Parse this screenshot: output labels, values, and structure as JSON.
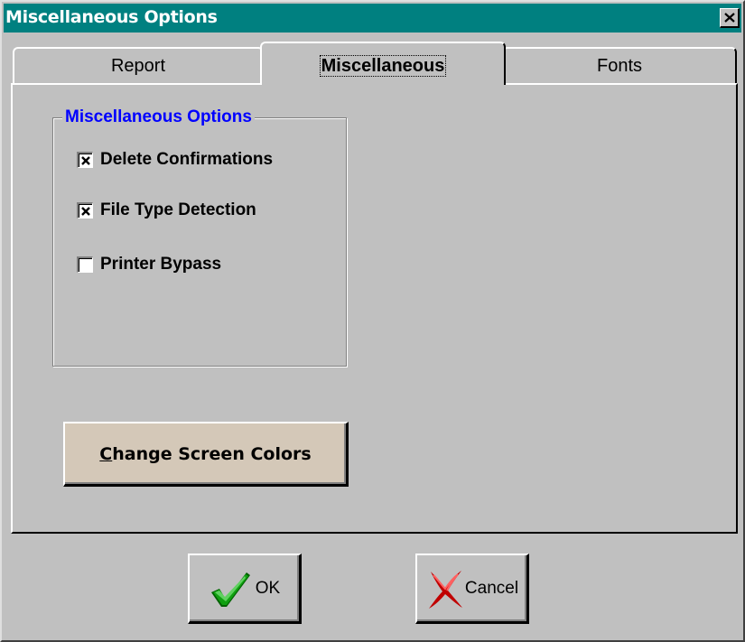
{
  "window": {
    "title": "Miscellaneous Options",
    "close_icon": "close-icon"
  },
  "tabs": [
    {
      "label": "Report",
      "active": false
    },
    {
      "label": "Miscellaneous",
      "active": true
    },
    {
      "label": "Fonts",
      "active": false
    }
  ],
  "group": {
    "legend": "Miscellaneous Options",
    "legend_color": "#0000ff",
    "options": [
      {
        "label": "Delete Confirmations",
        "checked": true
      },
      {
        "label": "File Type Detection",
        "checked": true
      },
      {
        "label": "Printer Bypass",
        "checked": false
      }
    ]
  },
  "change_colors_button": {
    "accel": "C",
    "rest": "hange Screen Colors"
  },
  "ok_button": {
    "label": "OK",
    "icon": "checkmark-icon"
  },
  "cancel_button": {
    "label": "Cancel",
    "icon": "red-x-icon"
  },
  "colors": {
    "titlebar": "#008080",
    "face": "#c0c0c0"
  }
}
